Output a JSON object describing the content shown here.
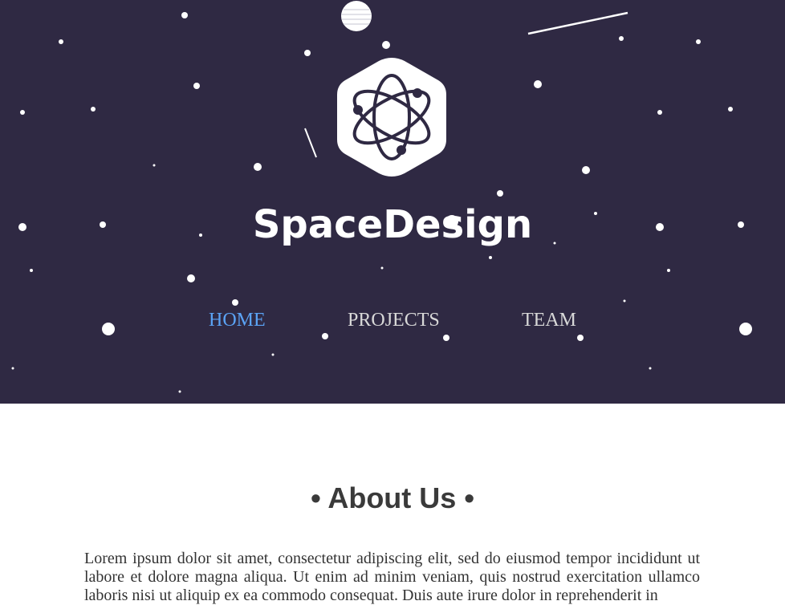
{
  "header": {
    "logo_icon": "atom-icon",
    "brand_name": "SpaceDesign",
    "background_color": "#2f2943"
  },
  "nav": {
    "items": [
      {
        "label": "HOME",
        "active": true
      },
      {
        "label": "PROJECTS",
        "active": false
      },
      {
        "label": "TEAM",
        "active": false
      }
    ],
    "active_color": "#5ba3f5"
  },
  "about": {
    "title": "• About Us •",
    "text": "Lorem ipsum dolor sit amet, consectetur adipiscing elit, sed do eiusmod tempor incididunt ut labore et dolore magna aliqua. Ut enim ad minim veniam, quis nostrud exercitation ullamco laboris nisi ut aliquip ex ea commodo consequat. Duis aute irure dolor in reprehenderit in"
  }
}
